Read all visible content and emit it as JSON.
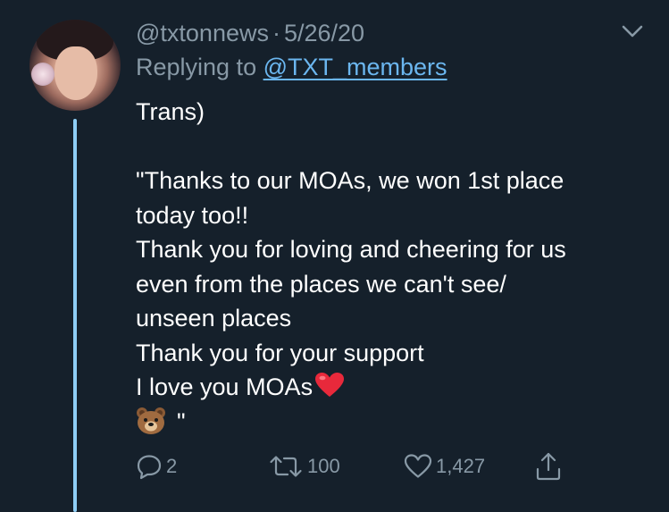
{
  "tweet": {
    "handle": "@txtonnews",
    "separator": "·",
    "date": "5/26/20",
    "replying_prefix": "Replying to",
    "replying_handle": "@TXT_members",
    "body_lines": [
      "Trans)",
      "",
      "\"Thanks to our MOAs, we won 1st place",
      "today too!!",
      "Thank you for loving and cheering for us",
      "even from the places we can't see/",
      "unseen places",
      "Thank you for your support",
      "I love you MOAs",
      "\""
    ],
    "counts": {
      "replies": "2",
      "retweets": "100",
      "likes": "1,427"
    }
  },
  "icons": {
    "avatar": "profile-photo",
    "menu": "chevron-down-icon",
    "reply": "comment-icon",
    "retweet": "retweet-icon",
    "like": "heart-outline-icon",
    "share": "share-icon",
    "emoji_heart": "red-heart-emoji",
    "emoji_bear": "bear-face-emoji"
  },
  "colors": {
    "background": "#15202b",
    "text": "#ffffff",
    "muted": "#8899a6",
    "link": "#6bb6ef",
    "thread_line": "#8ecdf4"
  }
}
